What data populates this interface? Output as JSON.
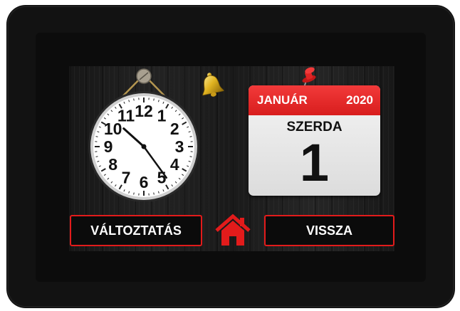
{
  "calendar": {
    "month": "JANUÁR",
    "year": "2020",
    "weekday": "SZERDA",
    "day": "1"
  },
  "clock": {
    "hour": 10,
    "minute": 24,
    "numerals": [
      "12",
      "1",
      "2",
      "3",
      "4",
      "5",
      "6",
      "7",
      "8",
      "9",
      "10",
      "11"
    ]
  },
  "buttons": {
    "change_label": "VÁLTOZTATÁS",
    "back_label": "VISSZA"
  },
  "icons": {
    "home": "home-icon",
    "bell": "bell-icon",
    "pin": "pushpin-icon"
  },
  "colors": {
    "accent_red": "#e21b1b",
    "calendar_header": "#e32626",
    "bell_gold": "#e0b320"
  }
}
